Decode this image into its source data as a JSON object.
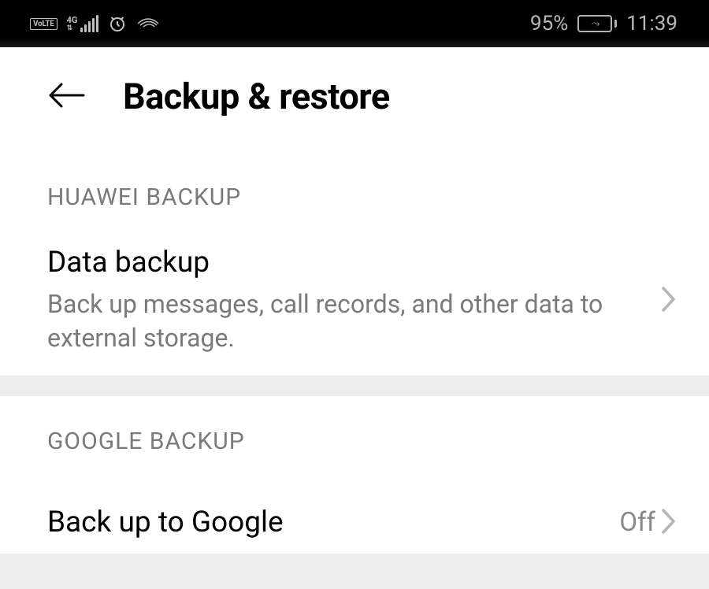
{
  "status_bar": {
    "volte_label": "VoLTE",
    "network_gen": "4G",
    "battery_percent": "95%",
    "time": "11:39"
  },
  "header": {
    "title": "Backup & restore"
  },
  "sections": {
    "huawei": {
      "header": "HUAWEI BACKUP",
      "data_backup": {
        "title": "Data backup",
        "subtitle": "Back up messages, call records, and other data to external storage."
      }
    },
    "google": {
      "header": "GOOGLE BACKUP",
      "back_up_to_google": {
        "title": "Back up to Google",
        "value": "Off"
      }
    }
  }
}
